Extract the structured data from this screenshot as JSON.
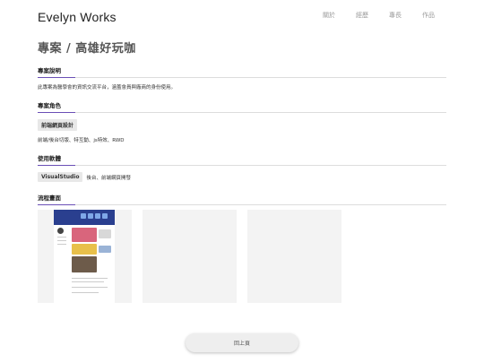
{
  "header": {
    "brand": "Evelyn Works",
    "nav": [
      "關於",
      "經歷",
      "專長",
      "作品"
    ]
  },
  "page": {
    "title": "專案 / 高雄好玩咖"
  },
  "sections": {
    "description": {
      "heading": "專案說明",
      "text": "此專案為醫學會的資訊交流平台，涵蓋會員與廠商的身份使用。"
    },
    "role": {
      "heading": "專案角色",
      "tag": "前端網頁設計",
      "text": "前端/後台切版、特互動、js特效、RWD"
    },
    "software": {
      "heading": "使用軟體",
      "tag": "VisualStudio",
      "text": "後台、前端網頁開發"
    },
    "flow": {
      "heading": "流程畫面"
    }
  },
  "colors": {
    "accent": "#6a4fb6",
    "banner": "#2a3f8f"
  },
  "footer": {
    "back_label": "回上頁"
  }
}
